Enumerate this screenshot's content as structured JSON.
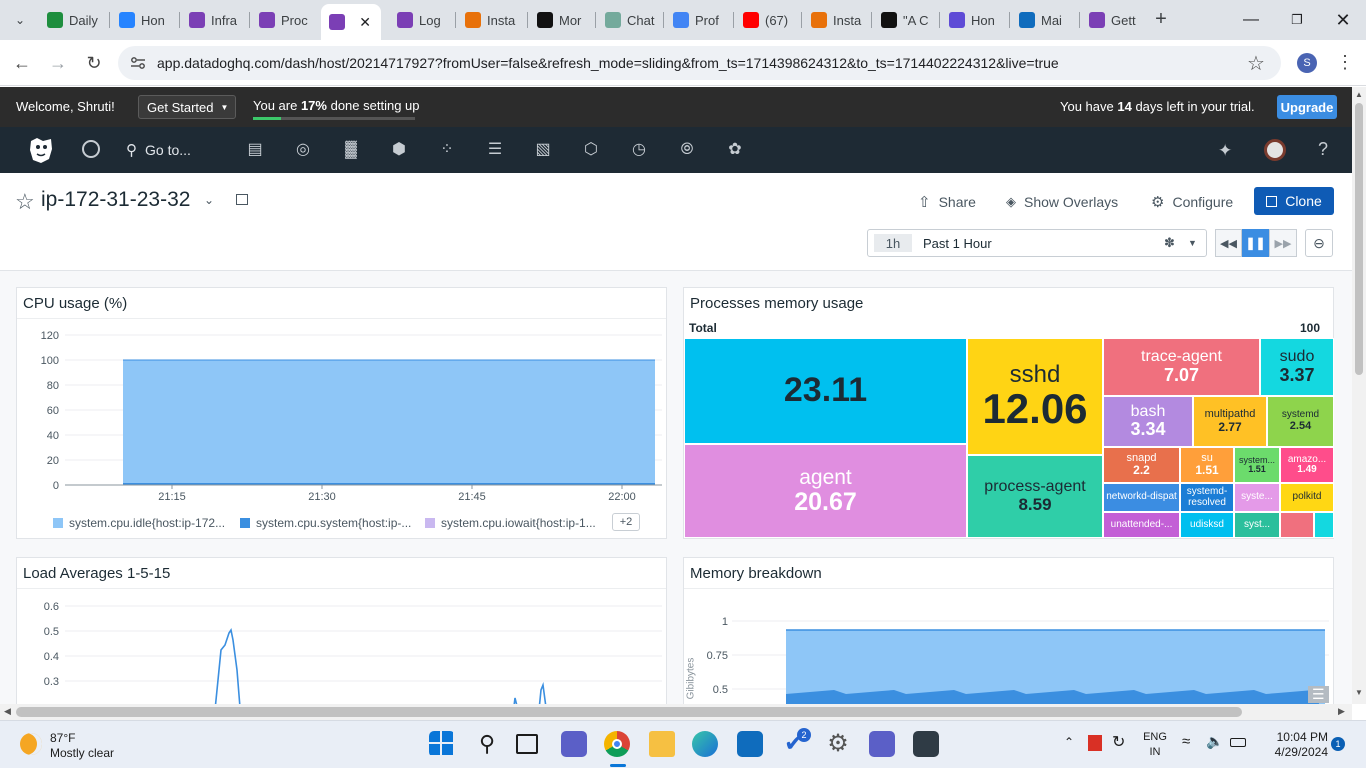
{
  "browser": {
    "tabs": [
      {
        "label": "Daily",
        "icon": "sheets-icon",
        "color": "#1e8e3e"
      },
      {
        "label": "Hon",
        "icon": "k-icon",
        "color": "#2684ff"
      },
      {
        "label": "Infra",
        "icon": "datadog-icon",
        "color": "#7b3fb5"
      },
      {
        "label": "Proc",
        "icon": "datadog-icon",
        "color": "#7b3fb5"
      },
      {
        "label": "",
        "icon": "datadog-icon",
        "color": "#7b3fb5"
      },
      {
        "label": "Log",
        "icon": "datadog-icon",
        "color": "#7b3fb5"
      },
      {
        "label": "Insta",
        "icon": "orange-icon",
        "color": "#e8710a"
      },
      {
        "label": "Mor",
        "icon": "medium-icon",
        "color": "#111111"
      },
      {
        "label": "Chat",
        "icon": "chatgpt-icon",
        "color": "#74aa9c"
      },
      {
        "label": "Prof",
        "icon": "gcloud-icon",
        "color": "#4285f4"
      },
      {
        "label": "(67)",
        "icon": "youtube-icon",
        "color": "#ff0000"
      },
      {
        "label": "Insta",
        "icon": "orange-icon",
        "color": "#e8710a"
      },
      {
        "label": "\"A C",
        "icon": "medium-icon",
        "color": "#111111"
      },
      {
        "label": "Hon",
        "icon": "k-icon",
        "color": "#5e4bd6"
      },
      {
        "label": "Mai",
        "icon": "outlook-icon",
        "color": "#0f6cbd"
      },
      {
        "label": "Gett",
        "icon": "datadog-icon",
        "color": "#7b3fb5"
      }
    ],
    "url": "app.datadoghq.com/dash/host/20214717927?fromUser=false&refresh_mode=sliding&from_ts=1714398624312&to_ts=1714402224312&live=true",
    "profile_initial": "S"
  },
  "trial": {
    "welcome": "Welcome, Shruti!",
    "get_started": "Get Started",
    "progress_prefix": "You are ",
    "progress_pct": "17%",
    "progress_suffix": " done setting up",
    "progress_value": 0.17,
    "days_prefix": "You have ",
    "days": "14",
    "days_suffix": " days left in your trial.",
    "upgrade": "Upgrade"
  },
  "nav": {
    "goto": "Go to...",
    "help": "?"
  },
  "dashboard": {
    "title": "ip-172-31-23-32",
    "share": "Share",
    "overlays": "Show Overlays",
    "configure": "Configure",
    "clone": "Clone",
    "time_badge": "1h",
    "time_label": "Past 1 Hour"
  },
  "cpu_widget": {
    "title": "CPU usage (%)",
    "legend": [
      "system.cpu.idle{host:ip-172...",
      "system.cpu.system{host:ip-...",
      "system.cpu.iowait{host:ip-1..."
    ],
    "legend_colors": [
      "#8ec6f7",
      "#3b8fe0",
      "#c9b8f0"
    ],
    "legend_more": "+2"
  },
  "proc_widget": {
    "title": "Processes memory usage",
    "total_label": "Total",
    "total_value": "100"
  },
  "load_widget": {
    "title": "Load Averages 1-5-15"
  },
  "mem_widget": {
    "title": "Memory breakdown",
    "ylabel": "Gibibytes"
  },
  "chart_data": [
    {
      "type": "area",
      "title": "CPU usage (%)",
      "x": [
        "21:15",
        "21:30",
        "21:45",
        "22:00"
      ],
      "yticks": [
        0,
        20,
        40,
        60,
        80,
        100,
        120
      ],
      "ylim": [
        0,
        120
      ],
      "series": [
        {
          "name": "system.cpu.idle{host:ip-172...",
          "values": [
            99,
            99,
            99,
            99
          ]
        },
        {
          "name": "system.cpu.system{host:ip-...",
          "values": [
            1,
            1,
            1,
            1
          ]
        },
        {
          "name": "system.cpu.iowait{host:ip-1...",
          "values": [
            0,
            0,
            0,
            0
          ]
        }
      ]
    },
    {
      "type": "heatmap",
      "title": "Processes memory usage",
      "categories": [
        "",
        "agent",
        "sshd",
        "process-agent",
        "trace-agent",
        "sudo",
        "bash",
        "multipathd",
        "systemd",
        "snapd",
        "su",
        "system...",
        "amazo...",
        "networkd-dispat",
        "systemd-resolved",
        "syste...",
        "polkitd",
        "unattended-...",
        "udisksd",
        "syst..."
      ],
      "values": [
        23.11,
        20.67,
        12.06,
        8.59,
        7.07,
        3.37,
        3.34,
        2.77,
        2.54,
        2.2,
        1.51,
        1.51,
        1.49,
        null,
        null,
        null,
        null,
        null,
        null,
        null
      ]
    },
    {
      "type": "line",
      "title": "Load Averages 1-5-15",
      "yticks": [
        0.3,
        0.4,
        0.5,
        0.6
      ],
      "ylim": [
        0.2,
        0.6
      ]
    },
    {
      "type": "area",
      "title": "Memory breakdown",
      "ylabel": "Gibibytes",
      "yticks": [
        0.5,
        0.75,
        1
      ]
    }
  ],
  "taskbar": {
    "temp": "87°F",
    "weather": "Mostly clear",
    "lang1": "ENG",
    "lang2": "IN",
    "time": "10:04 PM",
    "date": "4/29/2024",
    "notif": "1",
    "todo_badge": "2"
  }
}
